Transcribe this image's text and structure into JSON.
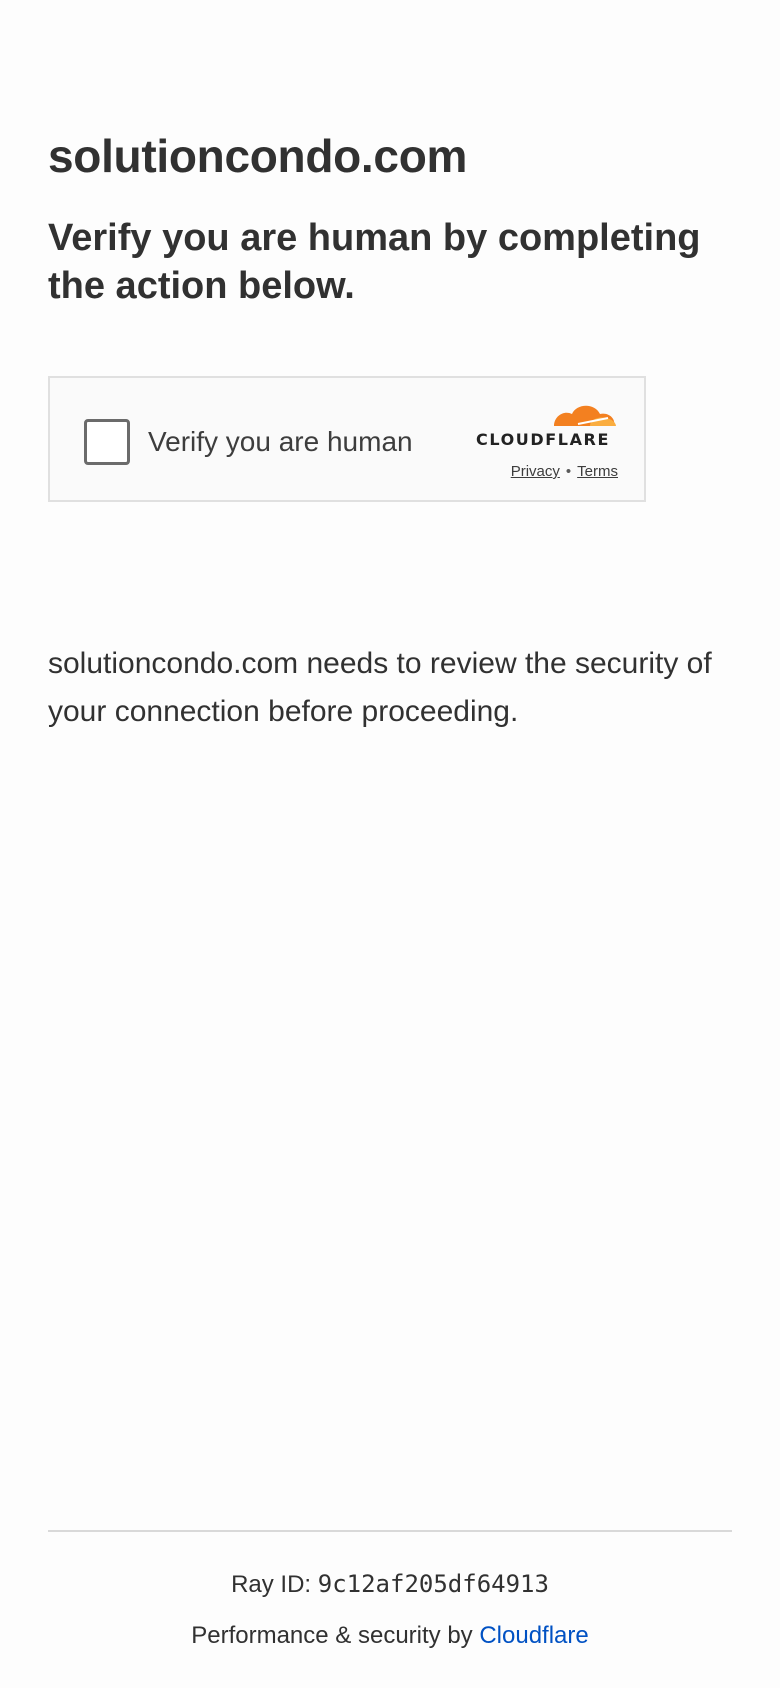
{
  "page": {
    "site_name": "solutioncondo.com",
    "headline": "Verify you are human by completing the action below.",
    "review_text": "solutioncondo.com needs to review the security of your connection before proceeding."
  },
  "widget": {
    "checkbox_label": "Verify you are human",
    "logo_text": "CLOUDFLARE",
    "privacy_link": "Privacy",
    "separator": "•",
    "terms_link": "Terms",
    "logo_colors": {
      "primary": "#f38020",
      "secondary": "#faad3f"
    }
  },
  "footer": {
    "ray_label": "Ray ID:",
    "ray_id": "9c12af205df64913",
    "perf_text": "Performance & security by",
    "perf_link": "Cloudflare",
    "link_color": "#0051c3"
  }
}
